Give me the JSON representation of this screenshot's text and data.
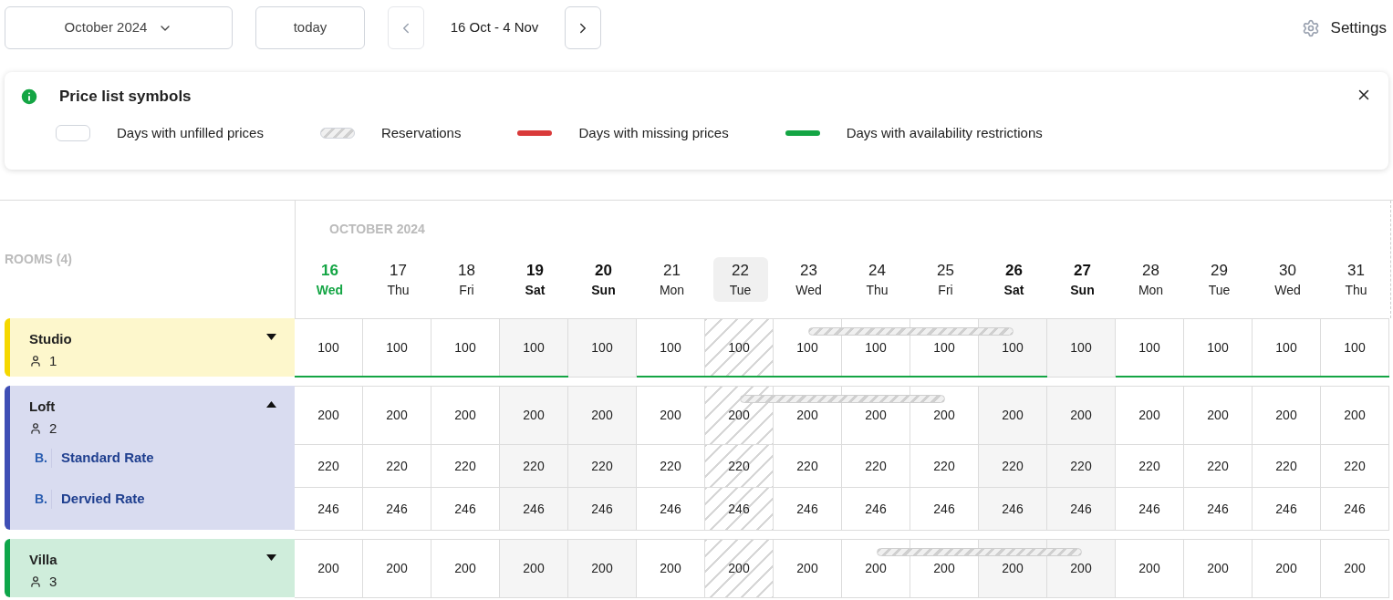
{
  "toolbar": {
    "month_select": "October 2024",
    "today_button": "today",
    "range": "16 Oct - 4 Nov",
    "settings": "Settings"
  },
  "legend": {
    "title": "Price list symbols",
    "items": [
      {
        "kind": "blank",
        "label": "Days with unfilled prices"
      },
      {
        "kind": "hatched",
        "label": "Reservations"
      },
      {
        "kind": "red",
        "label": "Days with missing prices"
      },
      {
        "kind": "green",
        "label": "Days with availability restrictions"
      }
    ]
  },
  "table": {
    "rooms_heading": "ROOMS (4)",
    "month_heading": "OCTOBER 2024",
    "days": [
      {
        "date": "16",
        "weekday": "Wed",
        "kind": "today",
        "selected": false,
        "closed": false
      },
      {
        "date": "17",
        "weekday": "Thu",
        "kind": "weekday",
        "selected": false,
        "closed": false
      },
      {
        "date": "18",
        "weekday": "Fri",
        "kind": "weekday",
        "selected": false,
        "closed": false
      },
      {
        "date": "19",
        "weekday": "Sat",
        "kind": "weekend",
        "selected": false,
        "closed": false
      },
      {
        "date": "20",
        "weekday": "Sun",
        "kind": "weekend",
        "selected": false,
        "closed": false
      },
      {
        "date": "21",
        "weekday": "Mon",
        "kind": "weekday",
        "selected": false,
        "closed": false
      },
      {
        "date": "22",
        "weekday": "Tue",
        "kind": "weekday",
        "selected": true,
        "closed": true
      },
      {
        "date": "23",
        "weekday": "Wed",
        "kind": "weekday",
        "selected": false,
        "closed": false
      },
      {
        "date": "24",
        "weekday": "Thu",
        "kind": "weekday",
        "selected": false,
        "closed": false
      },
      {
        "date": "25",
        "weekday": "Fri",
        "kind": "weekday",
        "selected": false,
        "closed": false
      },
      {
        "date": "26",
        "weekday": "Sat",
        "kind": "weekend",
        "selected": false,
        "closed": false
      },
      {
        "date": "27",
        "weekday": "Sun",
        "kind": "weekend",
        "selected": false,
        "closed": false
      },
      {
        "date": "28",
        "weekday": "Mon",
        "kind": "weekday",
        "selected": false,
        "closed": false
      },
      {
        "date": "29",
        "weekday": "Tue",
        "kind": "weekday",
        "selected": false,
        "closed": false
      },
      {
        "date": "30",
        "weekday": "Wed",
        "kind": "weekday",
        "selected": false,
        "closed": false
      },
      {
        "date": "31",
        "weekday": "Thu",
        "kind": "weekday",
        "selected": false,
        "closed": false
      }
    ],
    "rooms": [
      {
        "name": "Studio",
        "guests": "1",
        "color": "#f5d800",
        "expanded": false,
        "cells": [
          {
            "price": "100",
            "restricted": true,
            "reserved": false
          },
          {
            "price": "100",
            "restricted": true,
            "reserved": false
          },
          {
            "price": "100",
            "restricted": true,
            "reserved": false
          },
          {
            "price": "100",
            "restricted": true,
            "reserved": false
          },
          {
            "price": "100",
            "restricted": false,
            "reserved": false
          },
          {
            "price": "100",
            "restricted": true,
            "reserved": false
          },
          {
            "price": "100",
            "restricted": true,
            "reserved": false
          },
          {
            "price": "100",
            "restricted": true,
            "reserved": true
          },
          {
            "price": "100",
            "restricted": true,
            "reserved": true
          },
          {
            "price": "100",
            "restricted": true,
            "reserved": true
          },
          {
            "price": "100",
            "restricted": true,
            "reserved": false
          },
          {
            "price": "100",
            "restricted": false,
            "reserved": false
          },
          {
            "price": "100",
            "restricted": true,
            "reserved": false
          },
          {
            "price": "100",
            "restricted": true,
            "reserved": false
          },
          {
            "price": "100",
            "restricted": true,
            "reserved": false
          },
          {
            "price": "100",
            "restricted": true,
            "reserved": false
          }
        ]
      },
      {
        "name": "Loft",
        "guests": "2",
        "color": "#3f4fb5",
        "expanded": true,
        "cells": [
          {
            "price": "200",
            "restricted": false,
            "reserved": false
          },
          {
            "price": "200",
            "restricted": false,
            "reserved": false
          },
          {
            "price": "200",
            "restricted": false,
            "reserved": false
          },
          {
            "price": "200",
            "restricted": false,
            "reserved": false
          },
          {
            "price": "200",
            "restricted": false,
            "reserved": false
          },
          {
            "price": "200",
            "restricted": false,
            "reserved": false
          },
          {
            "price": "200",
            "restricted": false,
            "reserved": true
          },
          {
            "price": "200",
            "restricted": false,
            "reserved": true
          },
          {
            "price": "200",
            "restricted": false,
            "reserved": true
          },
          {
            "price": "200",
            "restricted": false,
            "reserved": false
          },
          {
            "price": "200",
            "restricted": false,
            "reserved": false
          },
          {
            "price": "200",
            "restricted": false,
            "reserved": false
          },
          {
            "price": "200",
            "restricted": false,
            "reserved": false
          },
          {
            "price": "200",
            "restricted": false,
            "reserved": false
          },
          {
            "price": "200",
            "restricted": false,
            "reserved": false
          },
          {
            "price": "200",
            "restricted": false,
            "reserved": false
          }
        ],
        "rates": [
          {
            "badge": "B.",
            "name": "Standard Rate",
            "prices": [
              "220",
              "220",
              "220",
              "220",
              "220",
              "220",
              "220",
              "220",
              "220",
              "220",
              "220",
              "220",
              "220",
              "220",
              "220",
              "220"
            ]
          },
          {
            "badge": "B.",
            "name": "Dervied Rate",
            "prices": [
              "246",
              "246",
              "246",
              "246",
              "246",
              "246",
              "246",
              "246",
              "246",
              "246",
              "246",
              "246",
              "246",
              "246",
              "246",
              "246"
            ]
          }
        ]
      },
      {
        "name": "Villa",
        "guests": "3",
        "color": "#0ea64a",
        "expanded": false,
        "cells": [
          {
            "price": "200",
            "restricted": false,
            "reserved": false
          },
          {
            "price": "200",
            "restricted": false,
            "reserved": false
          },
          {
            "price": "200",
            "restricted": false,
            "reserved": false
          },
          {
            "price": "200",
            "restricted": false,
            "reserved": false
          },
          {
            "price": "200",
            "restricted": false,
            "reserved": false
          },
          {
            "price": "200",
            "restricted": false,
            "reserved": false
          },
          {
            "price": "200",
            "restricted": false,
            "reserved": false
          },
          {
            "price": "200",
            "restricted": false,
            "reserved": false
          },
          {
            "price": "200",
            "restricted": false,
            "reserved": true
          },
          {
            "price": "200",
            "restricted": false,
            "reserved": true
          },
          {
            "price": "200",
            "restricted": false,
            "reserved": true
          },
          {
            "price": "200",
            "restricted": false,
            "reserved": false
          },
          {
            "price": "200",
            "restricted": false,
            "reserved": false
          },
          {
            "price": "200",
            "restricted": false,
            "reserved": false
          },
          {
            "price": "200",
            "restricted": false,
            "reserved": false
          },
          {
            "price": "200",
            "restricted": false,
            "reserved": false
          }
        ]
      }
    ]
  }
}
